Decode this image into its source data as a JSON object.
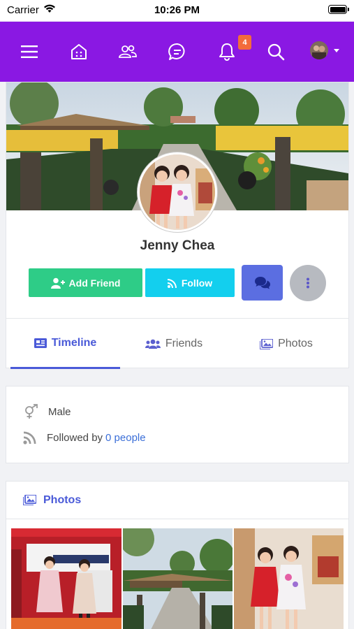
{
  "status_bar": {
    "carrier": "Carrier",
    "time": "10:26 PM"
  },
  "navbar": {
    "background": "#8a18e3",
    "icons": [
      "menu-icon",
      "home-icon",
      "friends-icon",
      "chat-icon",
      "bell-icon",
      "search-icon"
    ],
    "notification_count": "4"
  },
  "profile": {
    "name": "Jenny Chea",
    "add_friend_label": "Add Friend",
    "follow_label": "Follow",
    "add_friend_color": "#2ecc87",
    "follow_color": "#13cfee",
    "message_color": "#5b6ee1"
  },
  "tabs": [
    {
      "label": "Timeline",
      "active": true
    },
    {
      "label": "Friends",
      "active": false
    },
    {
      "label": "Photos",
      "active": false
    }
  ],
  "info": {
    "gender": "Male",
    "followed_prefix": "Followed by",
    "followed_link": "0 people"
  },
  "photos": {
    "title": "Photos",
    "accent": "#4a5ad8"
  }
}
